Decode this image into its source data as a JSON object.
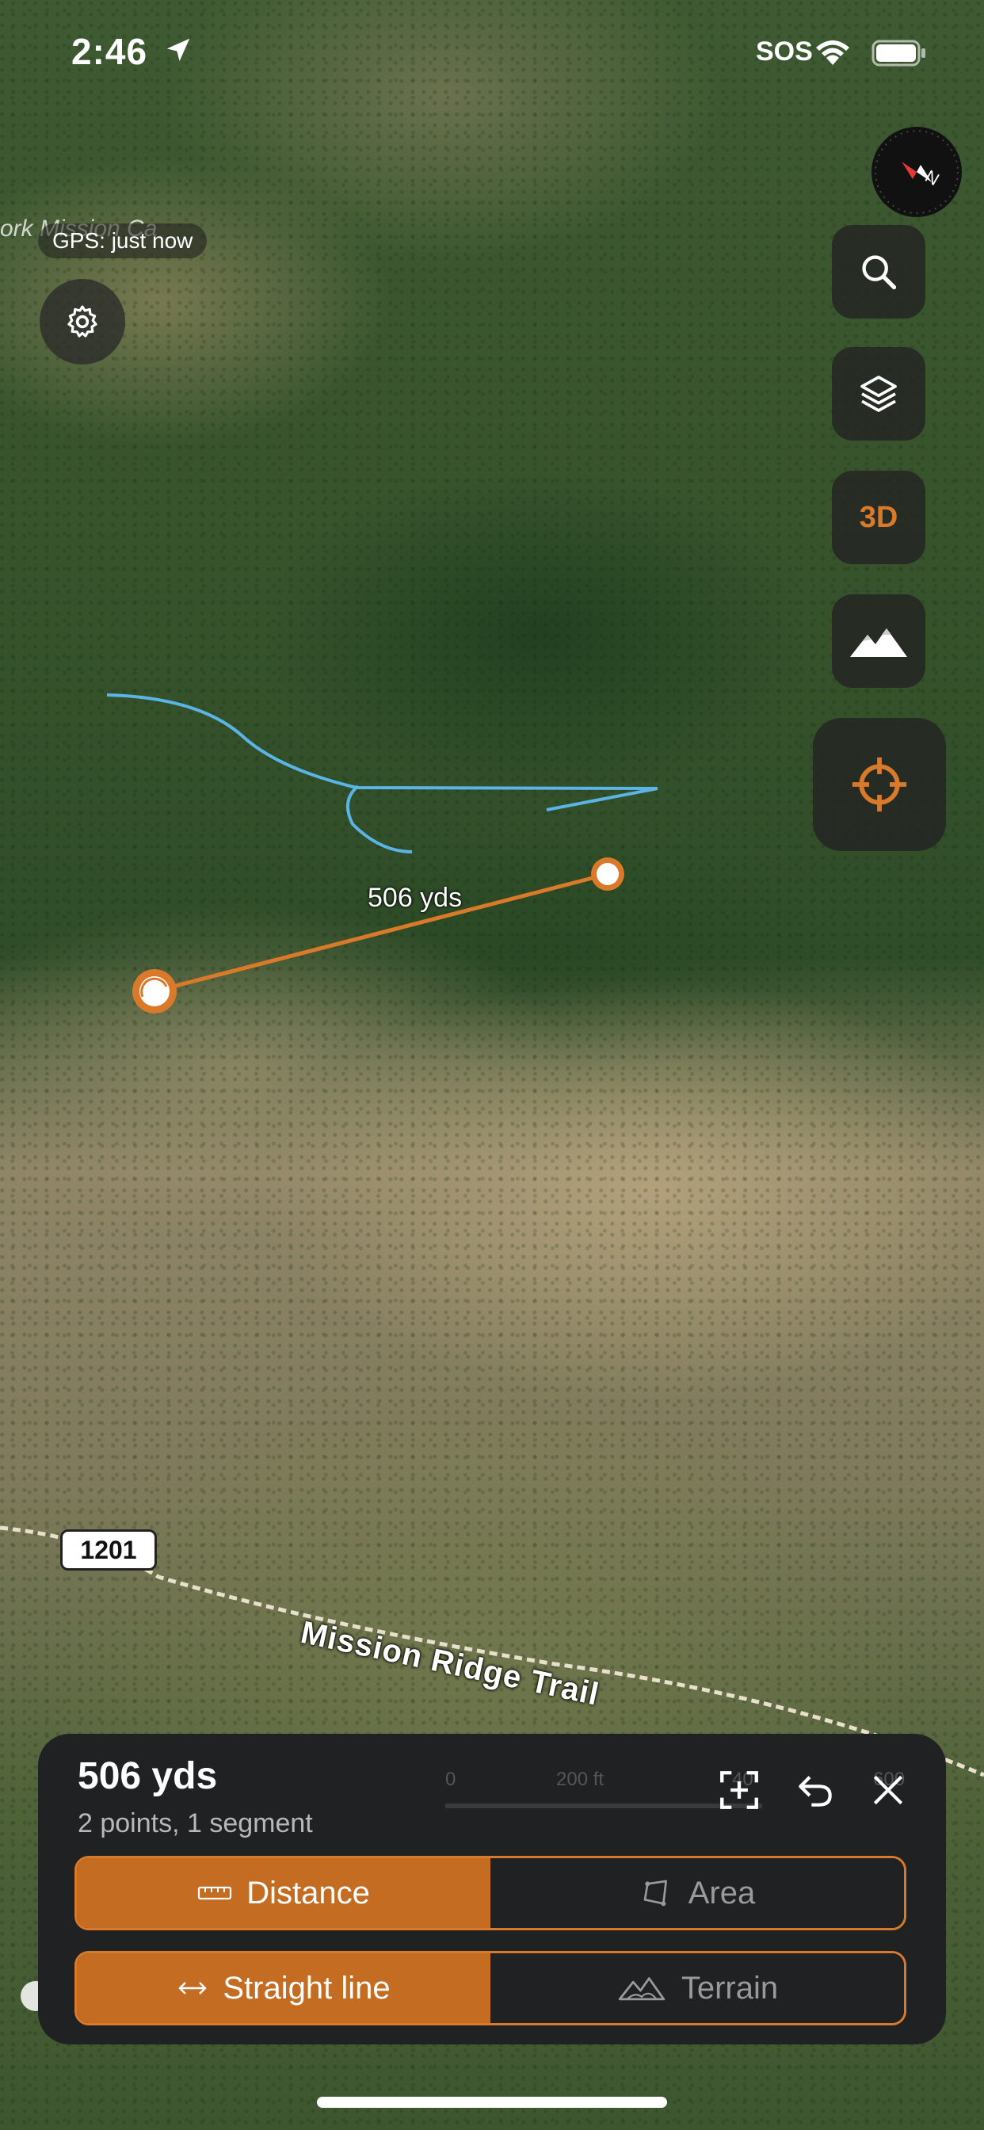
{
  "status_bar": {
    "time": "2:46",
    "sos": "SOS"
  },
  "map": {
    "place_name": "ork Mission Ca",
    "gps_status": "GPS: just now",
    "measure_label": "506 yds",
    "route_shield": "1201",
    "trail_name": "Mission Ridge Trail"
  },
  "controls": {
    "search": "search-icon",
    "layers": "layers-icon",
    "mode_3d": "3D",
    "terrain": "mountain-icon",
    "locate": "crosshair-icon",
    "accent_color": "#d9792a"
  },
  "panel": {
    "title": "506 yds",
    "subtitle": "2 points, 1 segment",
    "scale": {
      "labels": [
        "0",
        "200 ft",
        "40",
        "600"
      ]
    },
    "measure_type": {
      "options": [
        "Distance",
        "Area"
      ],
      "selected": "Distance"
    },
    "path_type": {
      "options": [
        "Straight line",
        "Terrain"
      ],
      "selected": "Straight line"
    }
  }
}
